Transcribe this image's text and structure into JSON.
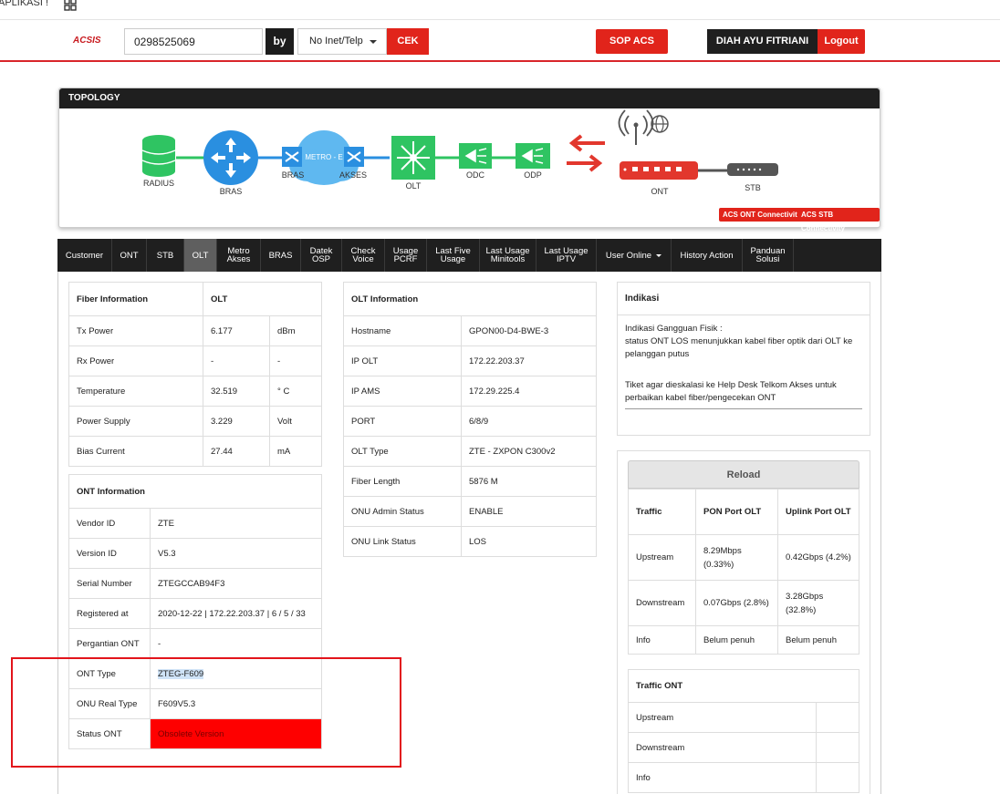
{
  "top_strip": {
    "label": "APLIKASI !"
  },
  "header": {
    "logo": "ACSIS",
    "search_value": "0298525069",
    "by_label": "by",
    "select_value": "No Inet/Telp",
    "cek_label": "CEK",
    "sop_label": "SOP ACS",
    "user_name": "DIAH AYU FITRIANI",
    "logout_label": "Logout"
  },
  "topology": {
    "title": "TOPOLOGY",
    "nodes": {
      "radius": "RADIUS",
      "bras": "BRAS",
      "metro_left": "BRAS",
      "metro_cloud": "METRO - E",
      "metro_right": "AKSES",
      "olt": "OLT",
      "odc": "ODC",
      "odp": "ODP",
      "ont": "ONT",
      "stb": "STB"
    },
    "acs_ont_btn": "ACS ONT Connectivity",
    "acs_stb_btn": "ACS STB Connectivity",
    "colors": {
      "green": "#2fc462",
      "blue": "#2a8fe0",
      "red": "#e2372d",
      "cloud": "#5fb8f0"
    }
  },
  "tabs": [
    {
      "label": "Customer"
    },
    {
      "label": "ONT"
    },
    {
      "label": "STB"
    },
    {
      "label": "OLT"
    },
    {
      "label": "Metro\nAkses"
    },
    {
      "label": "BRAS"
    },
    {
      "label": "Datek\nOSP"
    },
    {
      "label": "Check\nVoice"
    },
    {
      "label": "Usage\nPCRF"
    },
    {
      "label": "Last Five\nUsage"
    },
    {
      "label": "Last Usage\nMinitools"
    },
    {
      "label": "Last Usage\nIPTV"
    },
    {
      "label": "User Online"
    },
    {
      "label": "History Action"
    },
    {
      "label": "Panduan\nSolusi"
    }
  ],
  "fiber_info": {
    "header": [
      "Fiber Information",
      "OLT"
    ],
    "rows": [
      [
        "Tx Power",
        "6.177",
        "dBm"
      ],
      [
        "Rx Power",
        "-",
        "-"
      ],
      [
        "Temperature",
        "32.519",
        "° C"
      ],
      [
        "Power Supply",
        "3.229",
        "Volt"
      ],
      [
        "Bias Current",
        "27.44",
        "mA"
      ]
    ]
  },
  "ont_info": {
    "header": "ONT Information",
    "rows": [
      [
        "Vendor ID",
        "ZTE"
      ],
      [
        "Version ID",
        "V5.3"
      ],
      [
        "Serial Number",
        "ZTEGCCAB94F3"
      ],
      [
        "Registered at",
        "2020-12-22 | 172.22.203.37 | 6 / 5 / 33"
      ],
      [
        "Pergantian ONT",
        "-"
      ],
      [
        "ONT Type",
        "ZTEG-F609"
      ],
      [
        "ONU Real Type",
        "F609V5.3"
      ],
      [
        "Status ONT",
        "Obsolete Version"
      ]
    ]
  },
  "olt_info": {
    "header": "OLT Information",
    "rows": [
      [
        "Hostname",
        "GPON00-D4-BWE-3"
      ],
      [
        "IP OLT",
        "172.22.203.37"
      ],
      [
        "IP AMS",
        "172.29.225.4"
      ],
      [
        "PORT",
        "6/8/9"
      ],
      [
        "OLT Type",
        "ZTE - ZXPON C300v2"
      ],
      [
        "Fiber Length",
        "5876 M"
      ],
      [
        "ONU Admin Status",
        "ENABLE"
      ],
      [
        "ONU Link Status",
        "LOS"
      ]
    ]
  },
  "indikasi": {
    "title": "Indikasi",
    "line1": "Indikasi Gangguan Fisik :",
    "line2": "status ONT LOS menunjukkan kabel fiber optik dari OLT ke pelanggan putus",
    "line3": "Tiket agar dieskalasi ke Help Desk Telkom Akses untuk perbaikan kabel fiber/pengecekan ONT"
  },
  "traffic": {
    "reload_label": "Reload",
    "headers": [
      "Traffic",
      "PON Port OLT",
      "Uplink Port OLT"
    ],
    "rows": [
      [
        "Upstream",
        "8.29Mbps (0.33%)",
        "0.42Gbps (4.2%)"
      ],
      [
        "Downstream",
        "0.07Gbps (2.8%)",
        "3.28Gbps (32.8%)"
      ],
      [
        "Info",
        "Belum penuh",
        "Belum penuh"
      ]
    ]
  },
  "traffic_ont": {
    "header": "Traffic ONT",
    "rows": [
      "Upstream",
      "Downstream",
      "Info"
    ]
  },
  "status_colors": {
    "obsolete_bg": "#fe0000",
    "highlight_bg": "#cfe3f7"
  }
}
